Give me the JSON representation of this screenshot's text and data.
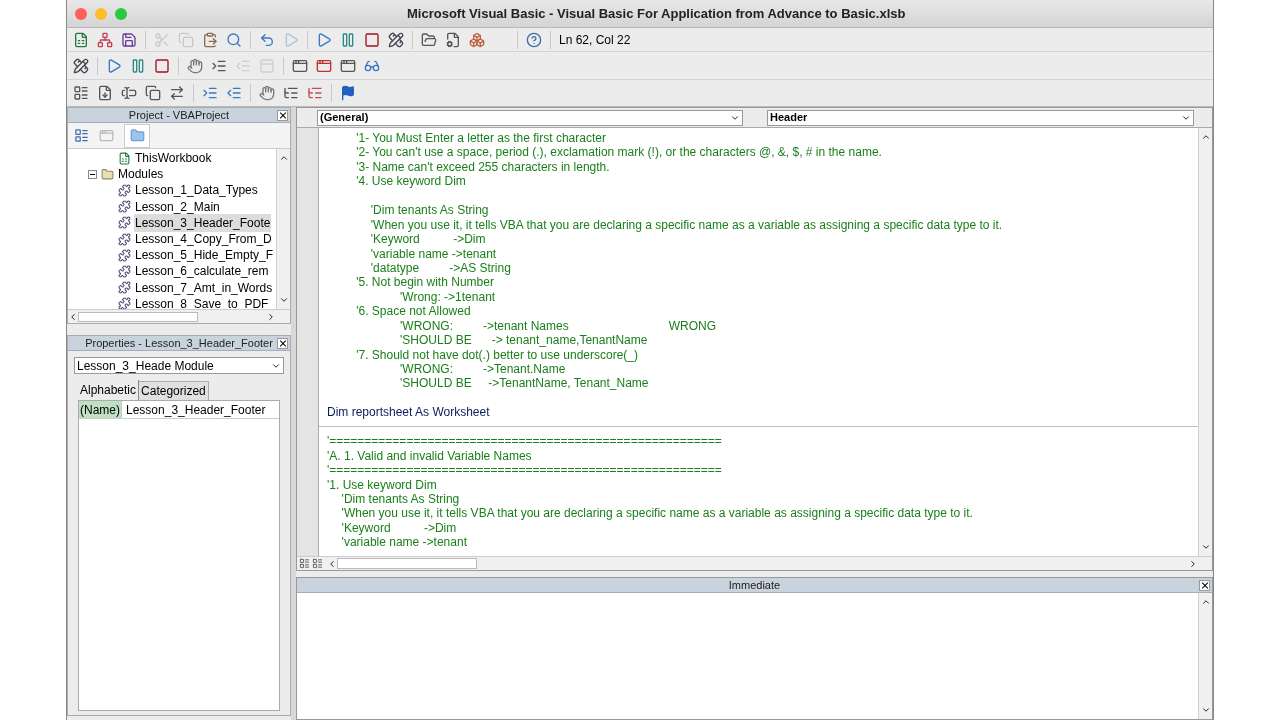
{
  "window": {
    "title": "Microsoft Visual Basic - Visual Basic For Application from Advance to Basic.xlsb"
  },
  "status": {
    "position": "Ln 62, Col 22"
  },
  "project": {
    "title": "Project - VBAProject",
    "tree": [
      {
        "label": "ThisWorkbook",
        "kind": "workbook",
        "selected": false
      },
      {
        "label": "Modules",
        "kind": "folder",
        "selected": false,
        "expanded": true,
        "children": [
          {
            "label": "Lesson_1_Data_Types",
            "kind": "module",
            "selected": false
          },
          {
            "label": "Lesson_2_Main",
            "kind": "module",
            "selected": false
          },
          {
            "label": "Lesson_3_Header_Foote",
            "kind": "module",
            "selected": true
          },
          {
            "label": "Lesson_4_Copy_From_D",
            "kind": "module",
            "selected": false
          },
          {
            "label": "Lesson_5_Hide_Empty_F",
            "kind": "module",
            "selected": false
          },
          {
            "label": "Lesson_6_calculate_rem",
            "kind": "module",
            "selected": false
          },
          {
            "label": "Lesson_7_Amt_in_Words",
            "kind": "module",
            "selected": false
          },
          {
            "label": "Lesson_8_Save_to_PDF",
            "kind": "module",
            "selected": false
          }
        ]
      }
    ]
  },
  "properties": {
    "title": "Properties - Lesson_3_Header_Footer",
    "object_name": "Lesson_3_Heade",
    "object_type": "Module",
    "tabs": [
      {
        "label": "Alphabetic",
        "selected": true
      },
      {
        "label": "Categorized",
        "selected": false
      }
    ],
    "rows": [
      {
        "name": "(Name)",
        "value": "Lesson_3_Header_Footer",
        "selected": true
      }
    ]
  },
  "code": {
    "object": "(General)",
    "procedure": "Header",
    "lines": [
      {
        "kind": "comment",
        "text": "\t\t'1- You Must Enter a letter as the first character"
      },
      {
        "kind": "comment",
        "text": "\t\t'2- You can't use a space, period (.), exclamation mark (!), or the characters @, &, $, # in the name."
      },
      {
        "kind": "comment",
        "text": "\t\t'3- Name can't exceed 255 characters in length."
      },
      {
        "kind": "comment",
        "text": "\t\t'4. Use keyword Dim"
      },
      {
        "kind": "blank"
      },
      {
        "kind": "comment",
        "text": "\t\t\t'Dim tenants As String"
      },
      {
        "kind": "comment",
        "text": "\t\t\t'When you use it, it tells VBA that you are declaring a specific name as a variable as assigning a specific data type to it."
      },
      {
        "kind": "comment",
        "text": "\t\t\t'Keyword          ->Dim"
      },
      {
        "kind": "comment",
        "text": "\t\t\t'variable name ->tenant"
      },
      {
        "kind": "comment",
        "text": "\t\t\t'datatype         ->AS String"
      },
      {
        "kind": "comment",
        "text": "\t\t'5. Not begin with Number"
      },
      {
        "kind": "comment",
        "text": "\t\t\t\t\t'Wrong: ->1tenant"
      },
      {
        "kind": "comment",
        "text": "\t\t'6. Space not Allowed"
      },
      {
        "kind": "comment",
        "text": "\t\t\t\t\t'WRONG:         ->tenant Names                              WRONG"
      },
      {
        "kind": "comment",
        "text": "\t\t\t\t\t'SHOULD BE      -> tenant_name,TenantName"
      },
      {
        "kind": "comment",
        "text": "\t\t'7. Should not have dot(.) better to use underscore(_)"
      },
      {
        "kind": "comment",
        "text": "\t\t\t\t\t'WRONG:         ->Tenant.Name"
      },
      {
        "kind": "comment",
        "text": "\t\t\t\t\t'SHOULD BE     ->TenantName, Tenant_Name"
      },
      {
        "kind": "blank"
      },
      {
        "kind": "code",
        "text": "Dim reportsheet As Worksheet"
      },
      {
        "kind": "divider"
      },
      {
        "kind": "comment",
        "text": "'========================================================"
      },
      {
        "kind": "comment",
        "text": "'A. 1. Valid and invalid Variable Names"
      },
      {
        "kind": "comment",
        "text": "'========================================================"
      },
      {
        "kind": "comment",
        "text": "'1. Use keyword Dim"
      },
      {
        "kind": "comment",
        "text": "\t'Dim tenants As String"
      },
      {
        "kind": "comment",
        "text": "\t'When you use it, it tells VBA that you are declaring a specific name as a variable as assigning a specific data type to it."
      },
      {
        "kind": "comment",
        "text": "\t'Keyword          ->Dim"
      },
      {
        "kind": "comment",
        "text": "\t'variable name ->tenant"
      }
    ]
  },
  "immediate": {
    "title": "Immediate"
  }
}
